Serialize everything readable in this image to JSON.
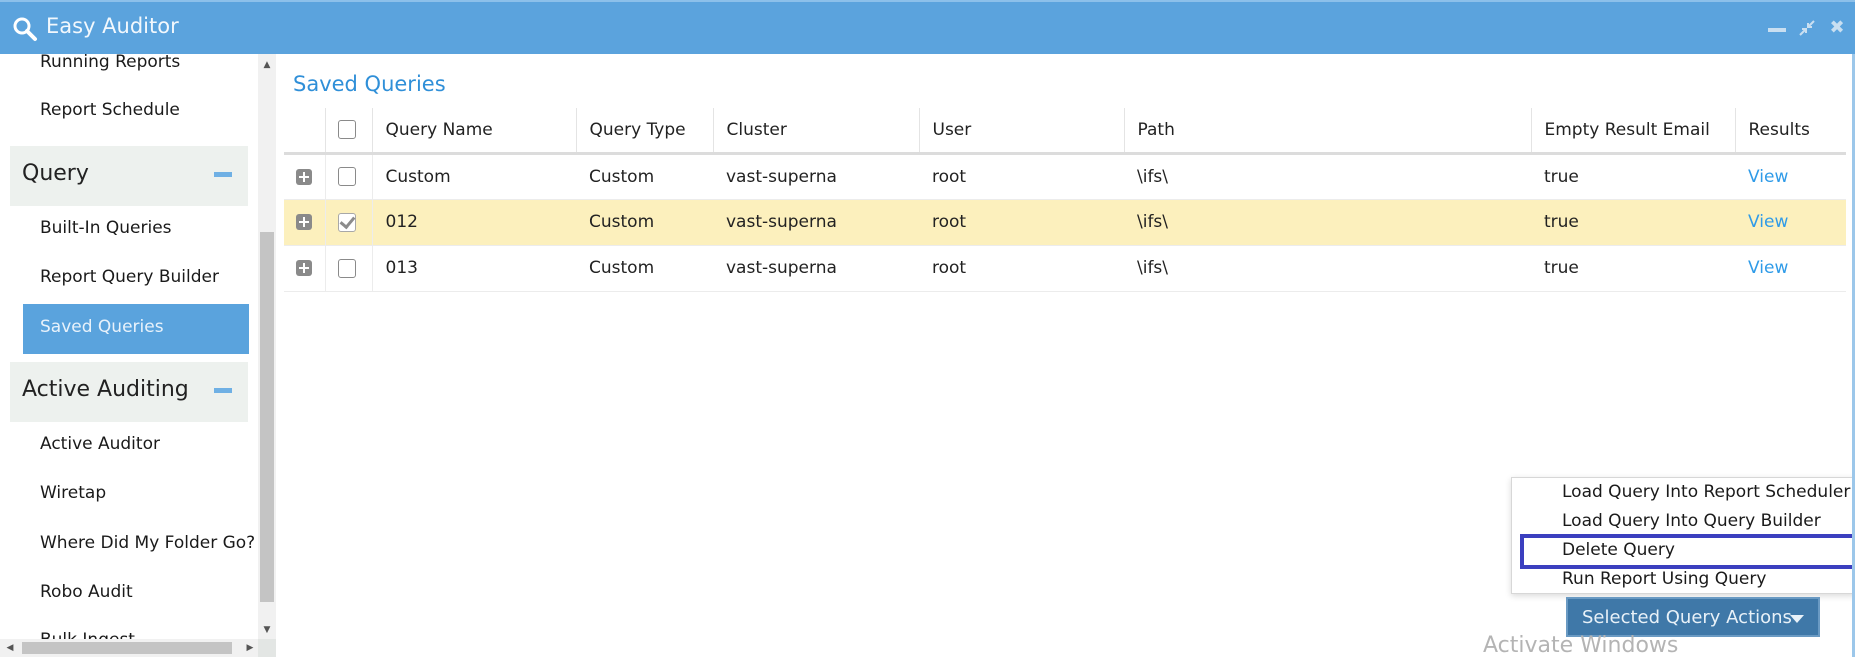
{
  "window": {
    "title": "Easy Auditor",
    "controls": [
      "minimize",
      "restore",
      "close"
    ]
  },
  "sidebar": {
    "items_top": [
      {
        "label": "Running Reports"
      },
      {
        "label": "Report Schedule"
      }
    ],
    "sections": [
      {
        "label": "Query",
        "collapse_icon": "minus-icon",
        "items": [
          {
            "label": "Built-In Queries",
            "active": false
          },
          {
            "label": "Report Query Builder",
            "active": false
          },
          {
            "label": "Saved Queries",
            "active": true
          }
        ]
      },
      {
        "label": "Active Auditing",
        "collapse_icon": "minus-icon",
        "items": [
          {
            "label": "Active Auditor"
          },
          {
            "label": "Wiretap"
          },
          {
            "label": "Where Did My Folder Go?"
          },
          {
            "label": "Robo Audit"
          },
          {
            "label": "Bulk Ingest"
          }
        ]
      }
    ]
  },
  "main": {
    "title": "Saved Queries",
    "table": {
      "columns": [
        "",
        "",
        "Query Name",
        "Query Type",
        "Cluster",
        "User",
        "Path",
        "Empty Result Email",
        "Results"
      ],
      "rows": [
        {
          "checked": false,
          "query_name": "Custom",
          "query_type": "Custom",
          "cluster": "vast-superna",
          "user": "root",
          "path": "\\ifs\\",
          "empty_result_email": "true",
          "results": "View"
        },
        {
          "checked": true,
          "query_name": "012",
          "query_type": "Custom",
          "cluster": "vast-superna",
          "user": "root",
          "path": "\\ifs\\",
          "empty_result_email": "true",
          "results": "View"
        },
        {
          "checked": false,
          "query_name": "013",
          "query_type": "Custom",
          "cluster": "vast-superna",
          "user": "root",
          "path": "\\ifs\\",
          "empty_result_email": "true",
          "results": "View"
        }
      ]
    },
    "actions_menu": {
      "items": [
        "Load Query Into Report Scheduler",
        "Load Query Into Query Builder",
        "Delete Query",
        "Run Report Using Query"
      ],
      "highlighted": "Delete Query"
    },
    "actions_button": "Selected Query Actions"
  },
  "watermark": "Activate Windows",
  "colors": {
    "titlebar": "#5ba3dd",
    "accent": "#2f8fd8",
    "active_nav": "#5aa3dd",
    "selected_row": "#fcf0bd",
    "action_button": "#3f78a8",
    "highlight_box": "#3b3fbf"
  }
}
